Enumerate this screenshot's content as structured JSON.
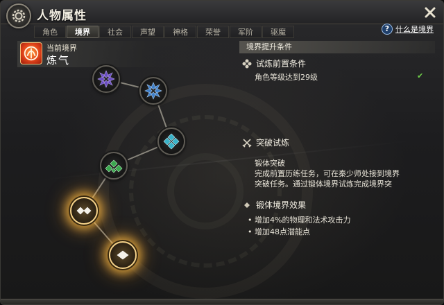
{
  "window": {
    "title": "人物属性"
  },
  "tabs": [
    {
      "label": "角色",
      "active": false
    },
    {
      "label": "境界",
      "active": true
    },
    {
      "label": "社会",
      "active": false
    },
    {
      "label": "声望",
      "active": false
    },
    {
      "label": "神格",
      "active": false
    },
    {
      "label": "荣誉",
      "active": false
    },
    {
      "label": "军阶",
      "active": false
    },
    {
      "label": "驱魔",
      "active": false
    }
  ],
  "help": {
    "label": "什么是境界",
    "icon": "question-icon"
  },
  "close_icon": "close-icon",
  "realm": {
    "label": "当前境界",
    "name": "炼气",
    "emblem_color": "#e0421a"
  },
  "tree_nodes": [
    {
      "name": "realm-node-1",
      "state": "locked",
      "gem_color": "#6a4cc2"
    },
    {
      "name": "realm-node-2",
      "state": "locked",
      "gem_color": "#3f7fc9"
    },
    {
      "name": "realm-node-3",
      "state": "locked",
      "gem_color": "#39b3c9"
    },
    {
      "name": "realm-node-4",
      "state": "locked",
      "gem_color": "#3aa84e"
    },
    {
      "name": "realm-node-5",
      "state": "active",
      "gem_color": "#f4f1e8"
    },
    {
      "name": "realm-node-6",
      "state": "active",
      "gem_color": "#f4f1e8"
    }
  ],
  "conditions": {
    "header": "境界提升条件",
    "prereq": {
      "title": "试炼前置条件",
      "requirement": "角色等级达到29级",
      "met_mark": "✔"
    },
    "breakthrough": {
      "title": "突破试炼",
      "name": "锻体突破",
      "desc_line1": "完成前置历练任务，可在秦少师处接到境界",
      "desc_line2": "突破任务。通过锻体境界试炼完成境界突"
    },
    "effects": {
      "title": "锻体境界效果",
      "items": [
        "增加4%的物理和法术攻击力",
        "增加48点潜能点"
      ]
    }
  }
}
